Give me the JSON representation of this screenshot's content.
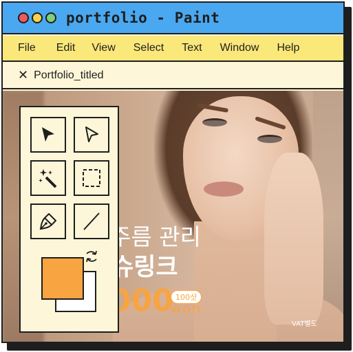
{
  "window": {
    "title": "portfolio - Paint",
    "controls": [
      "close",
      "minimize",
      "maximize"
    ]
  },
  "menu": {
    "items": [
      "File",
      "Edit",
      "View",
      "Select",
      "Text",
      "Window",
      "Help"
    ]
  },
  "tab": {
    "close_glyph": "✕",
    "label": "Portfolio_titled"
  },
  "artwork": {
    "line1": "주름 관리",
    "line2": "슈링크",
    "price": "000",
    "badge": "100샷",
    "unit": "won",
    "vat": "VAT별도"
  },
  "toolbox": {
    "tools": [
      "select-arrow-icon",
      "direct-select-icon",
      "magic-wand-icon",
      "marquee-select-icon",
      "pen-tool-icon",
      "line-tool-icon"
    ],
    "colors": {
      "foreground": "#f7a441",
      "background": "#ffffff"
    }
  },
  "theme": {
    "titlebar": "#4aa8f0",
    "menubar": "#fbe87a",
    "panel": "#fdf6d8",
    "accent": "#f7a441",
    "outline": "#1e1e1e"
  }
}
